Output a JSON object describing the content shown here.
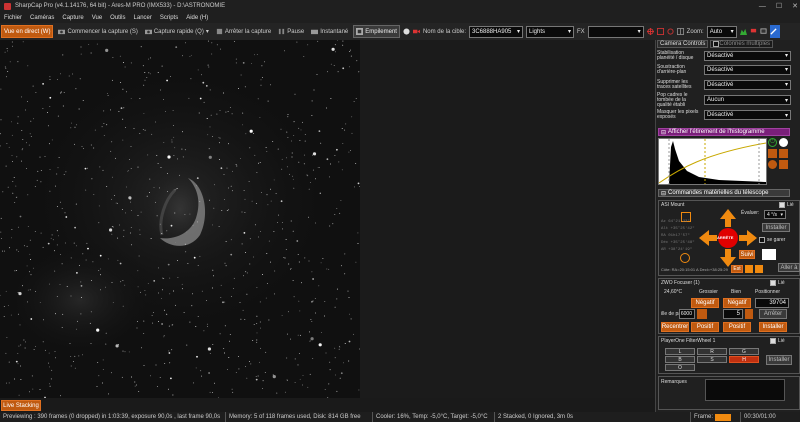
{
  "window": {
    "title": "SharpCap Pro (v4.1.14176, 64 bit) - Ares-M PRO (IMX533) - D:\\ASTRONOMIE",
    "min": "—",
    "max": "☐",
    "close": "✕"
  },
  "menu": [
    "Fichier",
    "Caméras",
    "Capture",
    "Vue",
    "Outils",
    "Lancer",
    "Scripts",
    "Aide (H)"
  ],
  "toolbar": {
    "live_view": "Vue en direct (W)",
    "start_capture": "Commencer la capture (S)",
    "quick_capture": "Capture rapide (Q)",
    "stop_capture": "Arrêter la capture",
    "pause": "Pause",
    "snapshot": "Instantané",
    "stacking": "Empilement",
    "target_label": "Nom de la cible:",
    "target_value": "3C6888HA905",
    "frame_type": "Lights",
    "fx_label": "FX",
    "zoom_label": "Zoom:",
    "zoom_value": "Auto"
  },
  "live_stacking": "Live Stacking",
  "status": {
    "preview": "Previewing : 390 frames (0 dropped) in 1:03:39, exposure 90,0s , last frame 90,0s",
    "memory": "Memory: 5 of 118 frames used, Disk: 814 GB free",
    "cooler": "Cooler: 16%, Temp: -5,0°C, Target: -5,0°C",
    "stack": "2 Stacked, 0 Ignored, 3m 0s",
    "frame_label": "Frame:",
    "time": "00:30/01:00"
  },
  "panel": {
    "tab_controls": "Camera Controls",
    "tab_multi": "Colonnes multiples",
    "settings": [
      {
        "label": "Stabilisation planéité / disque",
        "value": "Désactivé"
      },
      {
        "label": "Soustraction d'arrière-plan",
        "value": "Désactivé"
      },
      {
        "label": "Supprimer les traces satellites",
        "value": "Désactivé"
      },
      {
        "label": "Pop cadres le tombée de la qualité établi",
        "value": "Aucun"
      },
      {
        "label": "Masquer les pixels exposés",
        "value": "Désactivé"
      }
    ],
    "histogram": {
      "title": "Afficher l'étirement de l'histogramme"
    },
    "telescope": {
      "title": "Commandes matérielles du télescope",
      "mount_name": "ASI Mount",
      "linked": "Lié",
      "rate_label": "Évaluer:",
      "rate_value": "4 °/s",
      "install": "Installer",
      "park": "se garer",
      "stop": "ARRÊTE",
      "follow": "Suivi",
      "goto": "Aller à",
      "coords": [
        {
          "k": "Az",
          "v": "64°21'23\""
        },
        {
          "k": "Alt",
          "v": "+35°25'42\""
        },
        {
          "k": "RA",
          "v": "01h17'57\""
        },
        {
          "k": "Déc",
          "v": "+35°25'48\""
        },
        {
          "k": "AR",
          "v": "+38°24'19\""
        }
      ],
      "footer": "Côte: RA=20:15:01 A Decl=+38:25:29",
      "footer_btn": "Est"
    },
    "focuser": {
      "title": "ZWO Focuser (1)",
      "linked": "Lié",
      "temp": "24,60°C",
      "coarse": "Grossier",
      "fine": "Bien",
      "position_label": "Positionner",
      "neg1": "Négatif",
      "neg2": "Négatif",
      "position_value": "39704",
      "step_label": "ille de pas",
      "step_value": "6000",
      "fine_value": "5",
      "stop": "Arrêter",
      "center": "Recentrer",
      "pos1": "Positif",
      "pos2": "Positif",
      "install": "Installer"
    },
    "filterwheel": {
      "title": "PlayerOne FilterWheel 1",
      "linked": "Lié",
      "install": "Installer",
      "filters": [
        "L",
        "R",
        "G",
        "B",
        "S",
        "H",
        "O"
      ],
      "selected": "H"
    },
    "remarks": "Remarques"
  },
  "colors": {
    "accent": "#c05a10",
    "histogram_header": "#7a1f7a",
    "stop": "#e00000"
  }
}
